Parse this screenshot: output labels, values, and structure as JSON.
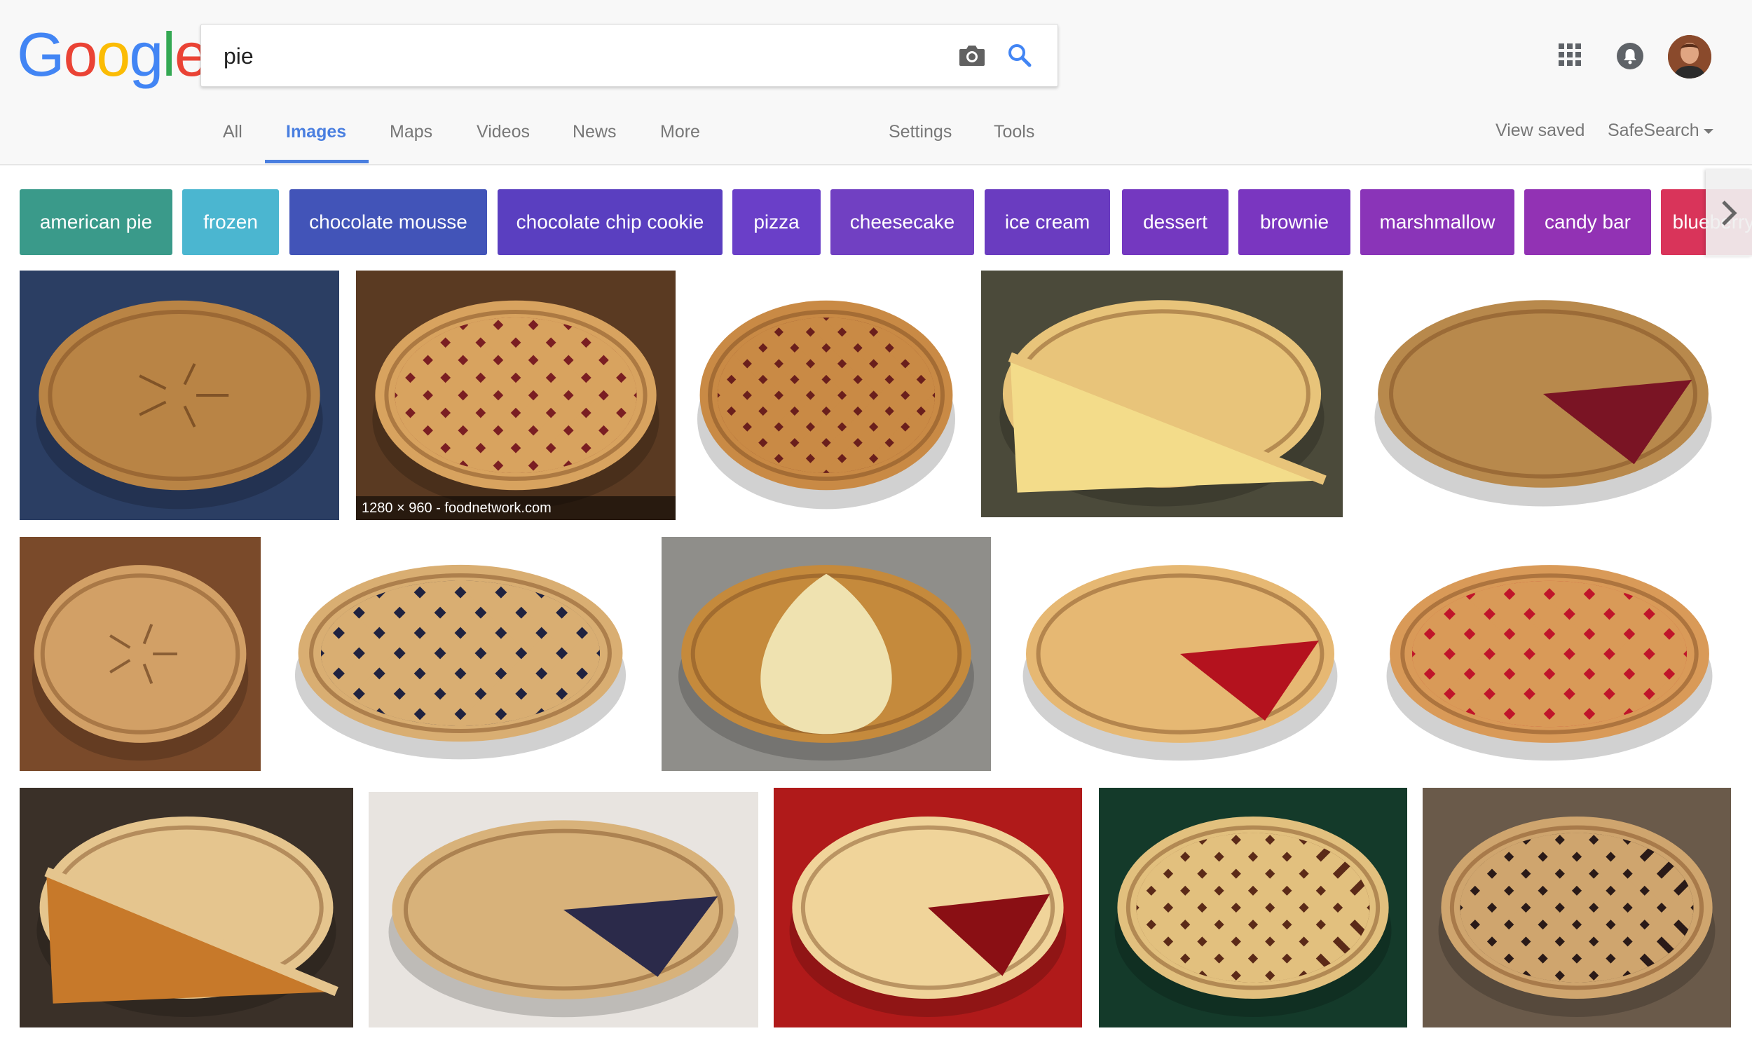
{
  "logo": {
    "letters": [
      "G",
      "o",
      "o",
      "g",
      "l",
      "e"
    ],
    "colors": [
      "#4285F4",
      "#EA4335",
      "#FBBC05",
      "#4285F4",
      "#34A853",
      "#EA4335"
    ]
  },
  "search": {
    "query": "pie",
    "camera_icon": "camera-icon",
    "search_icon": "search-icon"
  },
  "header_icons": {
    "apps": "apps-grid-icon",
    "notifications": "notifications-bell-icon",
    "avatar": "user-avatar"
  },
  "tabs": [
    {
      "label": "All"
    },
    {
      "label": "Images",
      "active": true
    },
    {
      "label": "Maps"
    },
    {
      "label": "Videos"
    },
    {
      "label": "News"
    },
    {
      "label": "More"
    }
  ],
  "tools": {
    "settings": "Settings",
    "tools": "Tools",
    "view_saved": "View saved",
    "safesearch": "SafeSearch"
  },
  "chips": [
    {
      "label": "american pie",
      "color": "#3a9a8a"
    },
    {
      "label": "frozen",
      "color": "#4bb6d0"
    },
    {
      "label": "chocolate mousse",
      "color": "#4254b8"
    },
    {
      "label": "chocolate chip cookie",
      "color": "#5a3fc0"
    },
    {
      "label": "pizza",
      "color": "#6a3fc8"
    },
    {
      "label": "cheesecake",
      "color": "#7140c2"
    },
    {
      "label": "ice cream",
      "color": "#6a3cc0"
    },
    {
      "label": "dessert",
      "color": "#7438c0"
    },
    {
      "label": "brownie",
      "color": "#7a36c0"
    },
    {
      "label": "marshmallow",
      "color": "#8a34b8"
    },
    {
      "label": "candy bar",
      "color": "#9232b4"
    },
    {
      "label": "blueberry",
      "color": "#d9345a"
    }
  ],
  "results": [
    {
      "name": "pie-image-1",
      "kind": "plain",
      "bg": "#2b3e63",
      "crust": "#b98445"
    },
    {
      "name": "pie-image-2",
      "kind": "lattice",
      "bg": "#5a3a22",
      "crust": "#d8a35f",
      "filling": "#7a1e22",
      "caption": "1280 × 960 - foodnetwork.com"
    },
    {
      "name": "pie-image-3",
      "kind": "lattice-small",
      "bg": "#ffffff",
      "crust": "#c98a45",
      "filling": "#6a1f1c"
    },
    {
      "name": "pie-image-4",
      "kind": "slice-plate",
      "bg": "#4b4a3a",
      "crust": "#e8c47a",
      "filling": "#f3dc8a"
    },
    {
      "name": "pie-image-5",
      "kind": "cherry-cut",
      "bg": "#ffffff",
      "crust": "#b8894c",
      "filling": "#7a1424"
    },
    {
      "name": "pie-image-6",
      "kind": "plain-round",
      "bg": "#7a4a2a",
      "crust": "#d2a066"
    },
    {
      "name": "pie-image-7",
      "kind": "blueberry-lattice",
      "bg": "#ffffff",
      "crust": "#d9ae72",
      "filling": "#1f2240"
    },
    {
      "name": "pie-image-8",
      "kind": "pear",
      "bg": "#8f8e8a",
      "crust": "#c58a3c",
      "filling": "#efe2b0"
    },
    {
      "name": "pie-image-9",
      "kind": "cherry-cut",
      "bg": "#ffffff",
      "crust": "#e6b873",
      "filling": "#b4121e"
    },
    {
      "name": "pie-image-10",
      "kind": "cherry-lattice",
      "bg": "#ffffff",
      "crust": "#d99a58",
      "filling": "#c0152a"
    },
    {
      "name": "pie-image-11",
      "kind": "pumpkin-slice",
      "bg": "#3a3028",
      "crust": "#e5c58e",
      "filling": "#c7792a"
    },
    {
      "name": "pie-image-12",
      "kind": "blueberry-cut",
      "bg": "#e8e4e0",
      "crust": "#d8b27a",
      "filling": "#2b2a4a"
    },
    {
      "name": "pie-image-13",
      "kind": "cherry-cut",
      "bg": "#b01a1a",
      "crust": "#f0d49a",
      "filling": "#8a0f14"
    },
    {
      "name": "pie-image-14",
      "kind": "lattice",
      "bg": "#143a2a",
      "crust": "#e2c07e",
      "filling": "#5b2a18"
    },
    {
      "name": "pie-image-15",
      "kind": "lattice-close",
      "bg": "#6a5a4a",
      "crust": "#cfa56e",
      "filling": "#2a1a18"
    }
  ]
}
